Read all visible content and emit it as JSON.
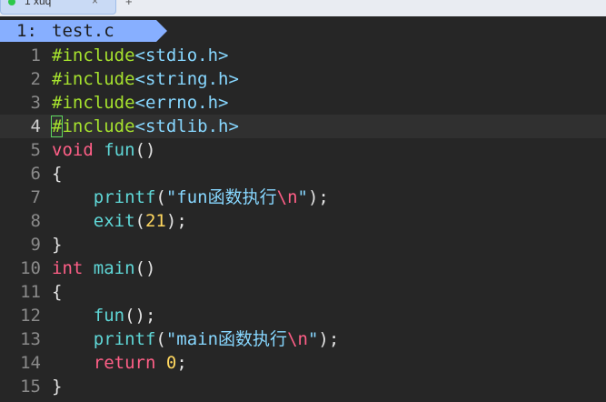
{
  "terminal": {
    "tab_label": "1 xuq",
    "close_glyph": "×",
    "new_tab_glyph": "+"
  },
  "vim": {
    "tab": {
      "number": "1:",
      "filename": "test.c"
    },
    "current_line": 4,
    "lines": [
      {
        "num": "1",
        "tokens": [
          {
            "t": "#include",
            "c": "pre"
          },
          {
            "t": "<stdio.h>",
            "c": "inc"
          }
        ]
      },
      {
        "num": "2",
        "tokens": [
          {
            "t": "#include",
            "c": "pre"
          },
          {
            "t": "<string.h>",
            "c": "inc"
          }
        ]
      },
      {
        "num": "3",
        "tokens": [
          {
            "t": "#include",
            "c": "pre"
          },
          {
            "t": "<errno.h>",
            "c": "inc"
          }
        ]
      },
      {
        "num": "4",
        "tokens": [
          {
            "t": "#",
            "c": "pre",
            "cursor": true
          },
          {
            "t": "include",
            "c": "pre"
          },
          {
            "t": "<stdlib.h>",
            "c": "inc"
          }
        ]
      },
      {
        "num": "5",
        "tokens": [
          {
            "t": "void",
            "c": "type"
          },
          {
            "t": " ",
            "c": "punct"
          },
          {
            "t": "fun",
            "c": "fn"
          },
          {
            "t": "()",
            "c": "punct"
          }
        ]
      },
      {
        "num": "6",
        "tokens": [
          {
            "t": "{",
            "c": "punct"
          }
        ]
      },
      {
        "num": "7",
        "tokens": [
          {
            "t": "    ",
            "c": "punct"
          },
          {
            "t": "printf",
            "c": "fn"
          },
          {
            "t": "(",
            "c": "punct"
          },
          {
            "t": "\"fun函数执行",
            "c": "str"
          },
          {
            "t": "\\n",
            "c": "esc"
          },
          {
            "t": "\"",
            "c": "str"
          },
          {
            "t": ");",
            "c": "punct"
          }
        ]
      },
      {
        "num": "8",
        "tokens": [
          {
            "t": "    ",
            "c": "punct"
          },
          {
            "t": "exit",
            "c": "fn"
          },
          {
            "t": "(",
            "c": "punct"
          },
          {
            "t": "21",
            "c": "num"
          },
          {
            "t": ");",
            "c": "punct"
          }
        ]
      },
      {
        "num": "9",
        "tokens": [
          {
            "t": "}",
            "c": "punct"
          }
        ]
      },
      {
        "num": "10",
        "tokens": [
          {
            "t": "int",
            "c": "type"
          },
          {
            "t": " ",
            "c": "punct"
          },
          {
            "t": "main",
            "c": "fn"
          },
          {
            "t": "()",
            "c": "punct"
          }
        ]
      },
      {
        "num": "11",
        "tokens": [
          {
            "t": "{",
            "c": "punct"
          }
        ]
      },
      {
        "num": "12",
        "tokens": [
          {
            "t": "    ",
            "c": "punct"
          },
          {
            "t": "fun",
            "c": "fn"
          },
          {
            "t": "();",
            "c": "punct"
          }
        ]
      },
      {
        "num": "13",
        "tokens": [
          {
            "t": "    ",
            "c": "punct"
          },
          {
            "t": "printf",
            "c": "fn"
          },
          {
            "t": "(",
            "c": "punct"
          },
          {
            "t": "\"main函数执行",
            "c": "str"
          },
          {
            "t": "\\n",
            "c": "esc"
          },
          {
            "t": "\"",
            "c": "str"
          },
          {
            "t": ");",
            "c": "punct"
          }
        ]
      },
      {
        "num": "14",
        "tokens": [
          {
            "t": "    ",
            "c": "punct"
          },
          {
            "t": "return",
            "c": "kw"
          },
          {
            "t": " ",
            "c": "punct"
          },
          {
            "t": "0",
            "c": "num"
          },
          {
            "t": ";",
            "c": "punct"
          }
        ]
      },
      {
        "num": "15",
        "tokens": [
          {
            "t": "}",
            "c": "punct"
          }
        ]
      }
    ]
  },
  "colors": {
    "background": "#262626",
    "tab_bg": "#87afff",
    "preprocessor": "#a6e22e",
    "include_path": "#87d7ff",
    "type_keyword": "#ff5f87",
    "function": "#5fd7d7",
    "number": "#ffd75f"
  }
}
